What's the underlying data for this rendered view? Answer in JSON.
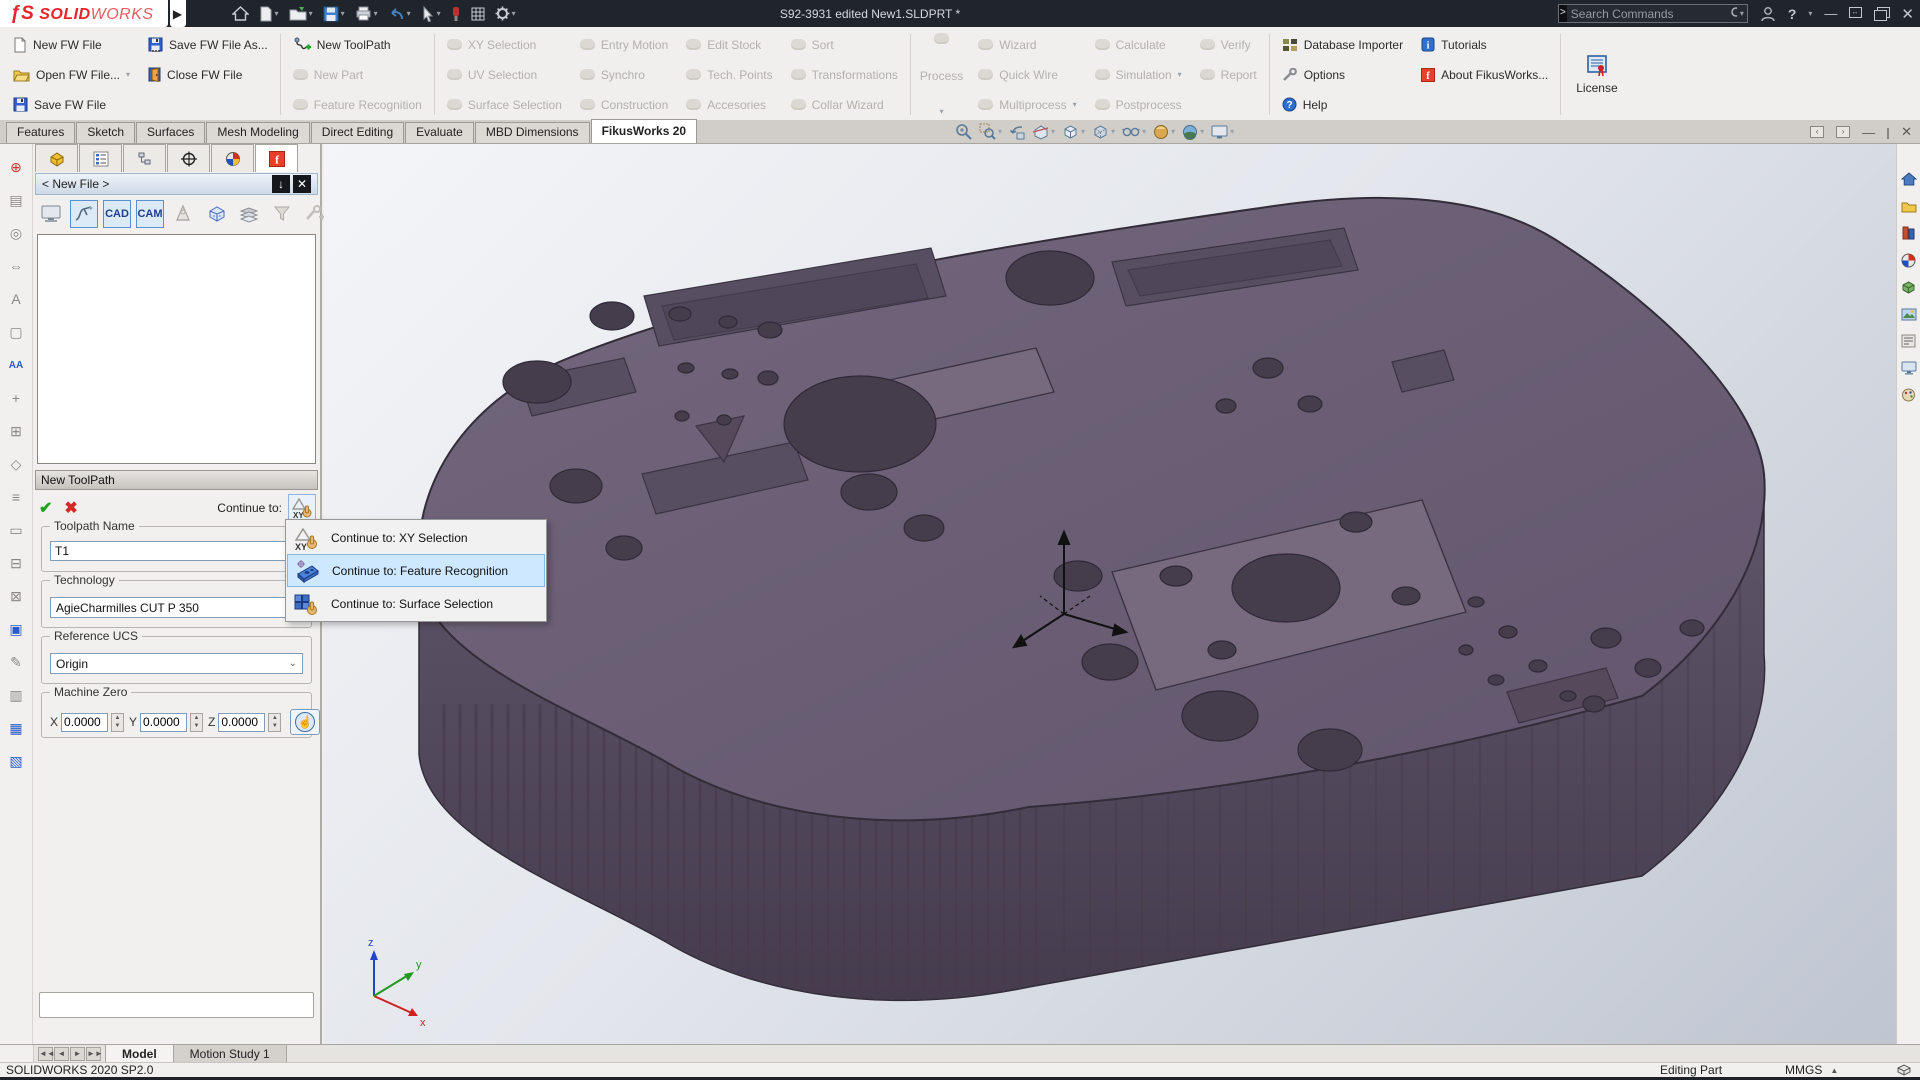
{
  "titlebar": {
    "logo_main": "SOLID",
    "logo_light": "WORKS",
    "document_title": "S92-3931 edited New1.SLDPRT *",
    "search_placeholder": "Search Commands",
    "icons": [
      "home-icon",
      "new-document-icon",
      "open-folder-icon",
      "save-icon",
      "print-icon",
      "undo-icon",
      "select-arrow-icon",
      "measure-icon",
      "grid-options-icon",
      "settings-gear-icon",
      "user-icon",
      "help-icon",
      "minimize-icon",
      "resize-icon",
      "windows-icon",
      "close-icon"
    ]
  },
  "ribbon": {
    "groups": [
      {
        "items": [
          {
            "label": "New FW File",
            "enabled": true
          },
          {
            "label": "Open FW File...",
            "enabled": true,
            "dropdown": true
          },
          {
            "label": "Save FW File",
            "enabled": true
          }
        ]
      },
      {
        "items": [
          {
            "label": "Save FW File As...",
            "enabled": true
          },
          {
            "label": "Close FW File",
            "enabled": true
          }
        ]
      },
      {
        "items": [
          {
            "label": "New ToolPath",
            "enabled": true
          },
          {
            "label": "New Part",
            "enabled": false
          },
          {
            "label": "Feature Recognition",
            "enabled": false
          }
        ]
      },
      {
        "items": [
          {
            "label": "XY Selection",
            "enabled": false
          },
          {
            "label": "UV Selection",
            "enabled": false
          },
          {
            "label": "Surface Selection",
            "enabled": false
          }
        ]
      },
      {
        "items": [
          {
            "label": "Entry Motion",
            "enabled": false
          },
          {
            "label": "Synchro",
            "enabled": false
          },
          {
            "label": "Construction",
            "enabled": false
          }
        ]
      },
      {
        "items": [
          {
            "label": "Edit Stock",
            "enabled": false
          },
          {
            "label": "Tech. Points",
            "enabled": false
          },
          {
            "label": "Accesories",
            "enabled": false
          }
        ]
      },
      {
        "items": [
          {
            "label": "Sort",
            "enabled": false
          },
          {
            "label": "Transformations",
            "enabled": false
          },
          {
            "label": "Collar Wizard",
            "enabled": false
          }
        ]
      },
      {
        "label": "Process",
        "enabled": false
      },
      {
        "items": [
          {
            "label": "Wizard",
            "enabled": false
          },
          {
            "label": "Quick Wire",
            "enabled": false
          },
          {
            "label": "Multiprocess",
            "enabled": false,
            "dropdown": true
          }
        ]
      },
      {
        "items": [
          {
            "label": "Calculate",
            "enabled": false
          },
          {
            "label": "Simulation",
            "enabled": false,
            "dropdown": true
          },
          {
            "label": "Postprocess",
            "enabled": false
          }
        ]
      },
      {
        "items": [
          {
            "label": "Verify",
            "enabled": false
          },
          {
            "label": "Report",
            "enabled": false
          }
        ]
      },
      {
        "items": [
          {
            "label": "Database Importer",
            "enabled": true
          },
          {
            "label": "Options",
            "enabled": true
          },
          {
            "label": "Help",
            "enabled": true
          }
        ]
      },
      {
        "items": [
          {
            "label": "Tutorials",
            "enabled": true
          },
          {
            "label": "About FikusWorks...",
            "enabled": true
          }
        ]
      },
      {
        "label": "License",
        "enabled": true
      }
    ]
  },
  "tabs": {
    "items": [
      "Features",
      "Sketch",
      "Surfaces",
      "Mesh Modeling",
      "Direct Editing",
      "Evaluate",
      "MBD Dimensions",
      "FikusWorks 20"
    ],
    "active": "FikusWorks 20"
  },
  "headsup_icons": [
    "zoom-fit-icon",
    "zoom-area-icon",
    "previous-view-icon",
    "section-view-icon",
    "view-orientation-icon",
    "display-style-icon",
    "hide-show-items-icon",
    "edit-appearance-icon",
    "apply-scene-icon",
    "view-settings-icon"
  ],
  "panel": {
    "header": "< New File >",
    "tab_icons": [
      "part-icon",
      "list-icon",
      "feature-tree-icon",
      "target-icon",
      "dimxpert-sphere-icon",
      "fikusworks-icon"
    ],
    "toolbar_icons": [
      "simulation-monitor-icon",
      "wire-path-icon",
      "cad-toggle",
      "cam-toggle",
      "wizard-icon",
      "stock-cube-icon",
      "layers-icon",
      "filter-icon",
      "tool-add-icon"
    ],
    "cad_label": "CAD",
    "cam_label": "CAM",
    "toolpath": {
      "title": "New ToolPath",
      "continue_label": "Continue to:",
      "name_label": "Toolpath Name",
      "name_value": "T1",
      "tech_label": "Technology",
      "tech_value": "AgieCharmilles CUT P 350",
      "ucs_label": "Reference UCS",
      "ucs_value": "Origin",
      "mz_label": "Machine Zero",
      "axis_x": "X",
      "axis_y": "Y",
      "axis_z": "Z",
      "mz_x": "0.0000",
      "mz_y": "0.0000",
      "mz_z": "0.0000"
    }
  },
  "context_menu": {
    "items": [
      {
        "label": "Continue to: XY Selection",
        "highlighted": false
      },
      {
        "label": "Continue to: Feature Recognition",
        "highlighted": true
      },
      {
        "label": "Continue to: Surface Selection",
        "highlighted": false
      }
    ]
  },
  "viewport": {
    "triad": {
      "x": "x",
      "y": "y",
      "z": "z"
    },
    "part_colors": {
      "top": "#6a5f73",
      "side_top": "#60566a",
      "side_bottom": "#453c4e",
      "hole": "#453c4c",
      "pocket": "#584e61",
      "island": "#77697e",
      "outline": "#332c39"
    }
  },
  "model_bar": {
    "tabs": [
      "Model",
      "Motion Study 1"
    ],
    "active": "Model"
  },
  "statusbar": {
    "left": "SOLIDWORKS 2020 SP2.0",
    "mode": "Editing Part",
    "units": "MMGS"
  }
}
